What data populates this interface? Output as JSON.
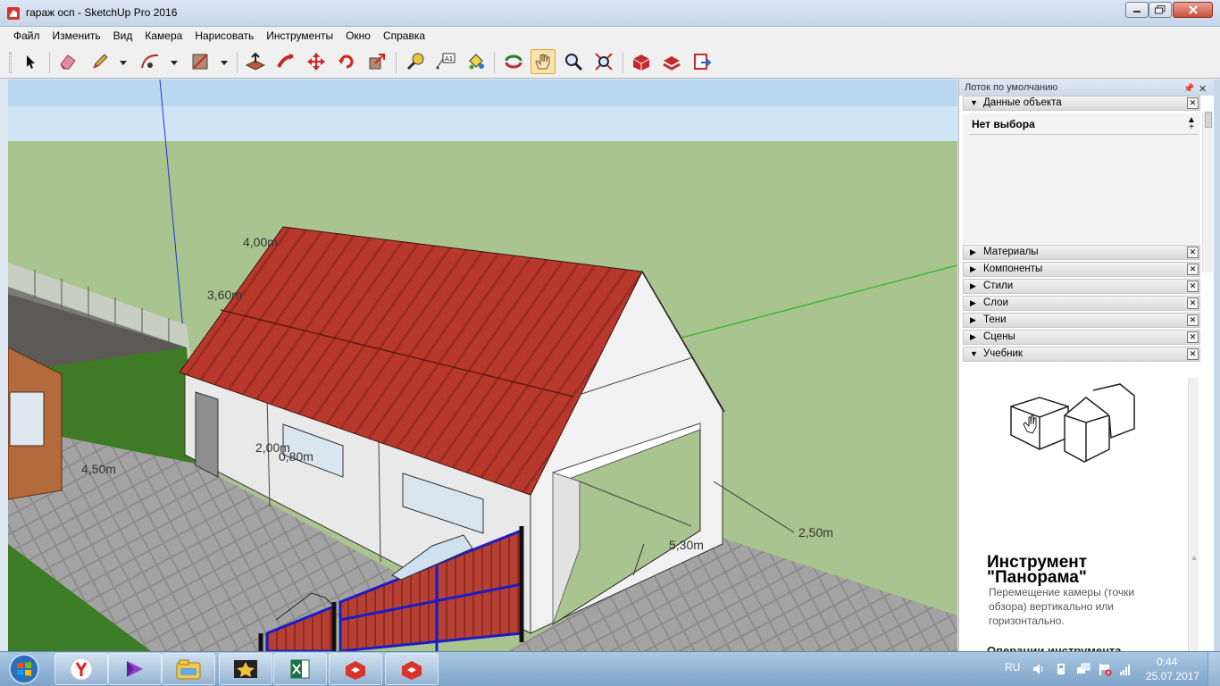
{
  "window": {
    "title": "гараж осп - SketchUp Pro 2016"
  },
  "menu": [
    "Файл",
    "Изменить",
    "Вид",
    "Камера",
    "Нарисовать",
    "Инструменты",
    "Окно",
    "Справка"
  ],
  "toolbar": {
    "tools": [
      "select-tool",
      "eraser-tool",
      "pencil-tool",
      "arc-tool",
      "rectangle-tool",
      "push-pull-tool",
      "follow-me-tool",
      "move-tool",
      "rotate-tool",
      "scale-tool",
      "tape-measure-tool",
      "text-tool",
      "paint-bucket-tool",
      "orbit-tool",
      "pan-tool",
      "zoom-tool",
      "zoom-extents-tool",
      "3d-warehouse-tool",
      "extension-warehouse-tool",
      "layout-send-tool"
    ],
    "active_tool": "pan-tool"
  },
  "viewport": {
    "sky_color": "#cfe4f4",
    "ground_color": "#a9c48f",
    "roof_color": "#b53a2e",
    "dimensions": [
      "4,00m",
      "3,60m",
      "2,00m",
      "0,80m",
      "4,50m",
      "2,50m",
      "5,30m"
    ]
  },
  "tray": {
    "title": "Лоток по умолчанию",
    "entity_info": {
      "label": "Данные объекта",
      "value": "Нет выбора"
    },
    "panels": [
      "Материалы",
      "Компоненты",
      "Стили",
      "Слои",
      "Тени",
      "Сцены",
      "Учебник"
    ],
    "instructor": {
      "title": "Инструмент \"Панорама\"",
      "description": "Перемещение камеры (точки обзора) вертикально или горизонтально.",
      "subheading": "Операции инструмента"
    }
  },
  "taskbar": {
    "apps": [
      "yandex-browser",
      "media-player",
      "file-explorer",
      "movie-maker",
      "excel",
      "sketchup",
      "sketchup-layout"
    ],
    "language": "RU",
    "time": "0:44",
    "date": "25.07.2017"
  }
}
